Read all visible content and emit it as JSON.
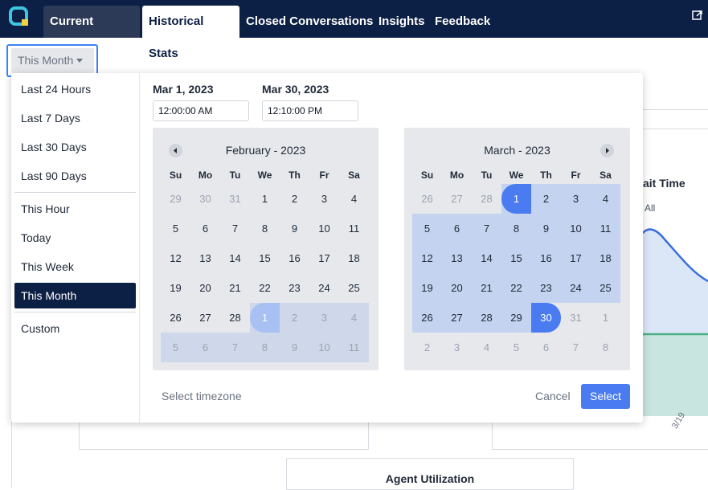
{
  "nav": {
    "tabs": [
      {
        "label": "Current Activity"
      },
      {
        "label": "Historical Stats"
      },
      {
        "label": "Closed Conversations"
      },
      {
        "label": "Insights"
      },
      {
        "label": "Feedback"
      }
    ],
    "active_tab": "Historical Stats"
  },
  "range_button": {
    "label": "This Month"
  },
  "presets": [
    "Last 24 Hours",
    "Last 7 Days",
    "Last 30 Days",
    "Last 90 Days",
    "This Hour",
    "Today",
    "This Week",
    "This Month",
    "Custom"
  ],
  "active_preset": "This Month",
  "start": {
    "date": "Mar 1, 2023",
    "time": "12:00:00 AM"
  },
  "end": {
    "date": "Mar 30, 2023",
    "time": "12:10:00 PM"
  },
  "weekdays": [
    "Su",
    "Mo",
    "Tu",
    "We",
    "Th",
    "Fr",
    "Sa"
  ],
  "calendars": [
    {
      "title": "February - 2023",
      "days": [
        [
          "29",
          "30",
          "31",
          "1",
          "2",
          "3",
          "4"
        ],
        [
          "5",
          "6",
          "7",
          "8",
          "9",
          "10",
          "11"
        ],
        [
          "12",
          "13",
          "14",
          "15",
          "16",
          "17",
          "18"
        ],
        [
          "19",
          "20",
          "21",
          "22",
          "23",
          "24",
          "25"
        ],
        [
          "26",
          "27",
          "28",
          "1",
          "2",
          "3",
          "4"
        ],
        [
          "5",
          "6",
          "7",
          "8",
          "9",
          "10",
          "11"
        ]
      ]
    },
    {
      "title": "March - 2023",
      "days": [
        [
          "26",
          "27",
          "28",
          "1",
          "2",
          "3",
          "4"
        ],
        [
          "5",
          "6",
          "7",
          "8",
          "9",
          "10",
          "11"
        ],
        [
          "12",
          "13",
          "14",
          "15",
          "16",
          "17",
          "18"
        ],
        [
          "19",
          "20",
          "21",
          "22",
          "23",
          "24",
          "25"
        ],
        [
          "26",
          "27",
          "28",
          "29",
          "30",
          "31",
          "1"
        ],
        [
          "2",
          "3",
          "4",
          "5",
          "6",
          "7",
          "8"
        ]
      ]
    }
  ],
  "footer": {
    "timezone": "Select timezone",
    "cancel": "Cancel",
    "select": "Select"
  },
  "background": {
    "wait_title": "ait Time",
    "legend_all": "All",
    "agent_utilization": "Agent Utilization",
    "axis_tick": "3/19"
  },
  "colors": {
    "navy": "#0c1f44",
    "accent": "#4a7bf0",
    "range": "#c4d3ef"
  }
}
